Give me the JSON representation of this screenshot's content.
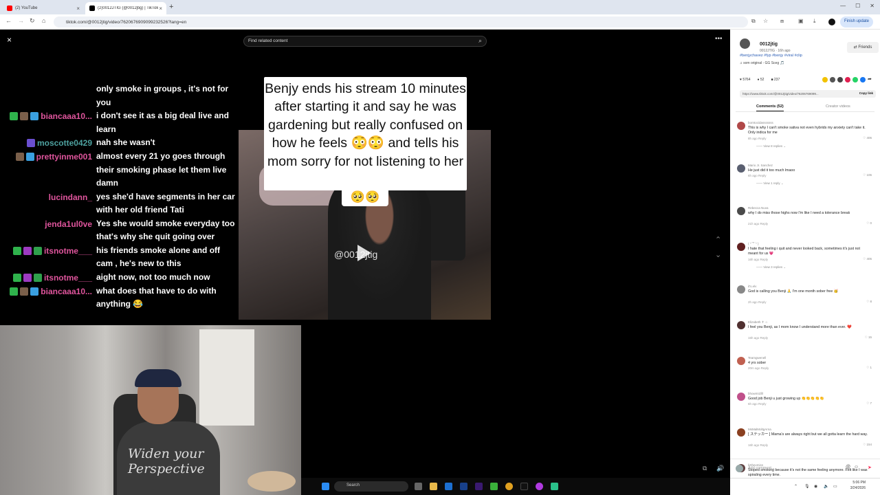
{
  "browser": {
    "tabs": [
      {
        "label": "(2) YouTube",
        "fav_color": "#ff0000"
      },
      {
        "label": "(2)0012JTIG (@0012jtig) | TikTok",
        "fav_color": "#000000"
      }
    ],
    "new_tab": "+",
    "url": "tiktok.com/@0012jtig/video/7620676909099232526?lang=en",
    "update_label": "Finish update"
  },
  "video": {
    "close": "×",
    "search_placeholder": "Find related content",
    "more": "•••",
    "caption": "Benjy ends  his stream  10 minutes after starting it and say he was  gardening  but really confused on how he feels 😳😳 and tells his mom sorry for not listening to her",
    "caption_tail": "🥺🥺",
    "watermark": "@0012jtig",
    "up": "⌃",
    "down": "⌄"
  },
  "chat": [
    {
      "user": "",
      "color": "#ffffff",
      "badges": [],
      "msg": "only smoke in groups , it's not for you"
    },
    {
      "user": "biancaaa10...",
      "color": "#e0559d",
      "badges": [
        "#2fb24c",
        "#7a5f4a",
        "#3aa0e0"
      ],
      "msg": "i don't see it as a big deal live and learn"
    },
    {
      "user": "moscotte0429",
      "color": "#4ea2a0",
      "badges": [
        "#6a4fd0"
      ],
      "msg": "nah she wasn't"
    },
    {
      "user": "prettyinme001",
      "color": "#e0559d",
      "badges": [
        "#7a5f4a",
        "#3aa0e0"
      ],
      "msg": "almost every 21 yo goes through their smoking phase let them live damn"
    },
    {
      "user": "lucindann_",
      "color": "#e0559d",
      "badges": [],
      "msg": "yes she'd have segments in her car with her old friend Tati"
    },
    {
      "user": "jenda1ul0ve",
      "color": "#e0559d",
      "badges": [],
      "msg": "Yes she would smoke everyday too that's why she quit going over"
    },
    {
      "user": "itsnotme___",
      "color": "#e0559d",
      "badges": [
        "#2fb24c",
        "#9c3ac0",
        "#2fa04c"
      ],
      "msg": "his friends smoke alone and off cam , he's new to this"
    },
    {
      "user": "itsnotme___",
      "color": "#e0559d",
      "badges": [
        "#2fb24c",
        "#9c3ac0",
        "#2fa04c"
      ],
      "msg": "aight now, not too much now"
    },
    {
      "user": "biancaaa10...",
      "color": "#e0559d",
      "badges": [
        "#2fb24c",
        "#7a5f4a",
        "#3aa0e0"
      ],
      "msg": "what does that have to do with anything 😂"
    }
  ],
  "webcam": {
    "shirt_text": "Widen your\nPerspective"
  },
  "panel": {
    "user": "0012jtig",
    "sub": "0012JTIG · 16h ago",
    "friends": "⇄ Friends",
    "hashtags": "#benjychavez #fyp #benjy #viral #clip",
    "sound": "♫  som original - GG Sceg 🎵",
    "likes": "5764",
    "comments_count": "52",
    "saves": "237",
    "link": "https://www.tiktok.com/@0012jtig/video/76206769099...",
    "copy_link": "Copy link",
    "tab_comments": "Comments (52)",
    "tab_creator": "Creator videos",
    "comments": [
      {
        "user": "borntocidasssssss",
        "text": "This is why I can't smoke sativa not even hybrids my anxiety can't take it. Only indica for me",
        "meta": "8h ago   Reply",
        "likes": "♡ 406",
        "replies": "—— View 8 replies ⌄",
        "av": "#b04848"
      },
      {
        "user": "Mario Jr. Sanchez",
        "text": "He just did it too much lmaoo",
        "meta": "6h ago   Reply",
        "likes": "♡ 106",
        "replies": "—— View 1 reply ⌄",
        "av": "#5a5f70"
      },
      {
        "user": "Rebecca Nuva",
        "text": "why I do miss those highs now I'm like I need a tolerance break",
        "meta": "21h ago   Reply",
        "likes": "♡ 0",
        "replies": "",
        "av": "#4a4a4a"
      },
      {
        "user": "( ᐢ˙꒳˙ᐢ )",
        "text": "I hate that feeling i quit and never looked back, sometimes it's just not meant for us 💗",
        "meta": "16h ago   Reply",
        "likes": "♡ 405",
        "replies": "—— View 3 replies ⌄",
        "av": "#602020"
      },
      {
        "user": "it's.elv",
        "text": "God is calling you Benji 🙏 I'm one month sober free 🥳",
        "meta": "2h ago   Reply",
        "likes": "♡ 8",
        "replies": "",
        "av": "#888"
      },
      {
        "user": "Elizabeth ✝ ☆",
        "text": "I feel you Benji, as I mom know I understand more than ever. ❤️",
        "meta": "15h ago   Reply",
        "likes": "♡ 15",
        "replies": "",
        "av": "#503030"
      },
      {
        "user": "Teamgwenell",
        "text": "4 yrs sober",
        "meta": "20m ago   Reply",
        "likes": "♡ 1",
        "replies": "",
        "av": "#c06050"
      },
      {
        "user": "bhowmi1fill",
        "text": "Good job Benji u just growing up 👏👏👏👏👏",
        "meta": "6h ago   Reply",
        "likes": "♡ 7",
        "replies": "",
        "av": "#c0508a"
      },
      {
        "user": "MsMalMoltgArna",
        "text": "[ ステッカー ] Mama's are always right but we all gotta learn the hard way.",
        "meta": "16h ago   Reply",
        "likes": "♡ 154",
        "replies": "",
        "av": "#8a4020"
      },
      {
        "user": "lizthevmiss",
        "text": "Stoped smoking because it's not the same feeling anymore. Felt like I was spiraling every time.",
        "meta": "2h ago   Reply",
        "likes": "♡ 0",
        "replies": "",
        "av": "#604040"
      }
    ],
    "add_comment": "Add comment..."
  },
  "taskbar": {
    "search": "Search",
    "time": "5:06 PM",
    "date": "3/24/2026"
  }
}
